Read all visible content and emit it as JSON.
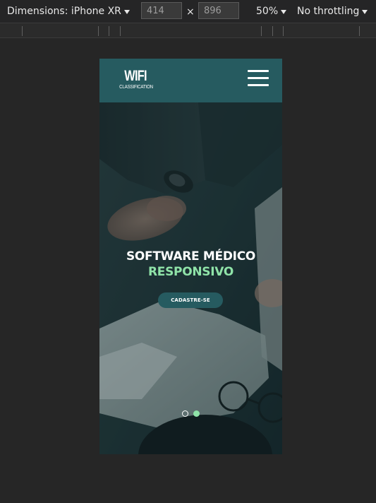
{
  "devtools": {
    "dimensions_label": "Dimensions: iPhone XR",
    "width_value": "414",
    "height_value": "896",
    "times_symbol": "×",
    "zoom_label": "50%",
    "throttle_label": "No throttling"
  },
  "site": {
    "logo_main": "WIFI",
    "logo_sub": "CLASSIFICATION",
    "menu_icon": "hamburger-menu-icon",
    "hero": {
      "title_line1": "SOFTWARE MÉDICO",
      "title_line2": "RESPONSIVO",
      "cta_label": "CADASTRE-SE",
      "slide_count": 2,
      "active_slide": 2
    }
  },
  "colors": {
    "navbar": "#265b60",
    "accent_green": "#8fe3a8",
    "devtools_bg": "#262626"
  }
}
